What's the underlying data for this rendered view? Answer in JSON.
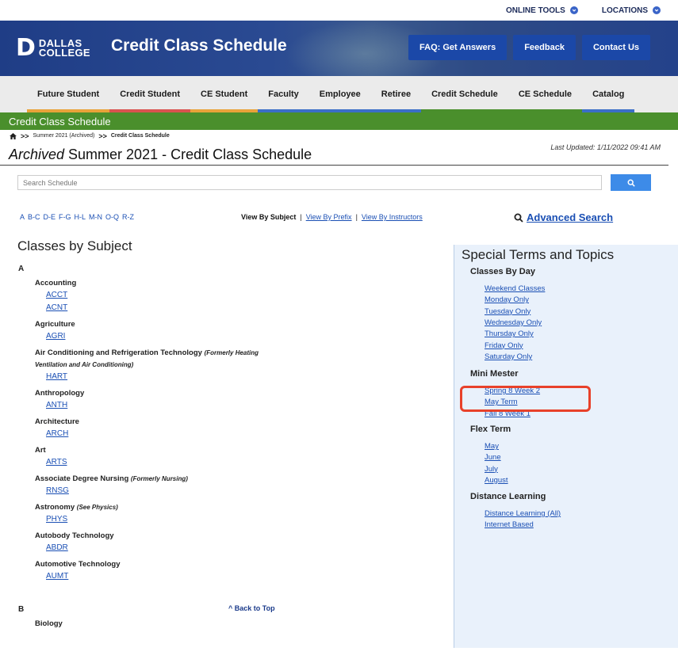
{
  "utility": {
    "online_tools": "ONLINE TOOLS",
    "locations": "LOCATIONS"
  },
  "brand": {
    "logo_line1": "DALLAS",
    "logo_line2": "COLLEGE",
    "title": "Credit Class Schedule"
  },
  "header_buttons": [
    "FAQ: Get Answers",
    "Feedback",
    "Contact Us"
  ],
  "nav": [
    {
      "label": "Future Student",
      "color": "#e8a33a"
    },
    {
      "label": "Credit Student",
      "color": "#d9534f"
    },
    {
      "label": "CE Student",
      "color": "#e8a33a"
    },
    {
      "label": "Faculty",
      "color": "#3b6fc7"
    },
    {
      "label": "Employee",
      "color": "#3b6fc7"
    },
    {
      "label": "Retiree",
      "color": "#3b6fc7"
    },
    {
      "label": "Credit Schedule",
      "color": "#4a8f2c"
    },
    {
      "label": "CE Schedule",
      "color": "#4a8f2c"
    },
    {
      "label": "Catalog",
      "color": "#3b6fc7"
    }
  ],
  "section_bar": "Credit Class Schedule",
  "breadcrumb": {
    "sep": ">>",
    "level1": "Summer 2021 (Archived)",
    "level2": "Credit Class Schedule"
  },
  "page": {
    "title_prefix": "Archived",
    "title_rest": " Summer 2021 - Credit Class Schedule",
    "last_updated": "Last Updated: 1/11/2022 09:41 AM"
  },
  "search": {
    "placeholder": "Search Schedule"
  },
  "alpha_ranges": [
    "A",
    "B-C",
    "D-E",
    "F-G",
    "H-L",
    "M-N",
    "O-Q",
    "R-Z"
  ],
  "views": {
    "subject": "View By Subject",
    "prefix": "View By Prefix",
    "instructors": "View By Instructors",
    "sep": "|"
  },
  "advanced_search": "Advanced Search",
  "classes": {
    "heading": "Classes by Subject",
    "letter_a": "A",
    "letter_b": "B",
    "back_to_top": "^ Back to Top",
    "subjects": [
      {
        "name": "Accounting",
        "note": "",
        "codes": [
          "ACCT",
          "ACNT"
        ]
      },
      {
        "name": "Agriculture",
        "note": "",
        "codes": [
          "AGRI"
        ]
      },
      {
        "name": "Air Conditioning and Refrigeration Technology",
        "note": "(Formerly Heating",
        "note2": "Ventilation and Air Conditioning)",
        "codes": [
          "HART"
        ]
      },
      {
        "name": "Anthropology",
        "note": "",
        "codes": [
          "ANTH"
        ]
      },
      {
        "name": "Architecture",
        "note": "",
        "codes": [
          "ARCH"
        ]
      },
      {
        "name": "Art",
        "note": "",
        "codes": [
          "ARTS"
        ]
      },
      {
        "name": "Associate Degree Nursing",
        "note": "(Formerly Nursing)",
        "codes": [
          "RNSG"
        ]
      },
      {
        "name": "Astronomy",
        "note": "(See Physics)",
        "codes": [
          "PHYS"
        ]
      },
      {
        "name": "Autobody Technology",
        "note": "",
        "codes": [
          "ABDR"
        ]
      },
      {
        "name": "Automotive Technology",
        "note": "",
        "codes": [
          "AUMT"
        ]
      }
    ],
    "b_first": "Biology"
  },
  "special": {
    "title": "Special Terms and Topics",
    "days_heading": "Classes By Day",
    "days": [
      "Weekend Classes",
      "Monday Only",
      "Tuesday Only",
      "Wednesday Only",
      "Thursday Only",
      "Friday Only",
      "Saturday Only"
    ],
    "mini_heading": "Mini Mester",
    "mini": [
      "Spring 8 Week 2",
      "May Term",
      "Fall 8 Week 1"
    ],
    "flex_heading": "Flex Term",
    "flex": [
      "May",
      "June",
      "July",
      "August"
    ],
    "distance_heading": "Distance Learning",
    "distance": [
      "Distance Learning (All)",
      "Internet Based"
    ]
  }
}
